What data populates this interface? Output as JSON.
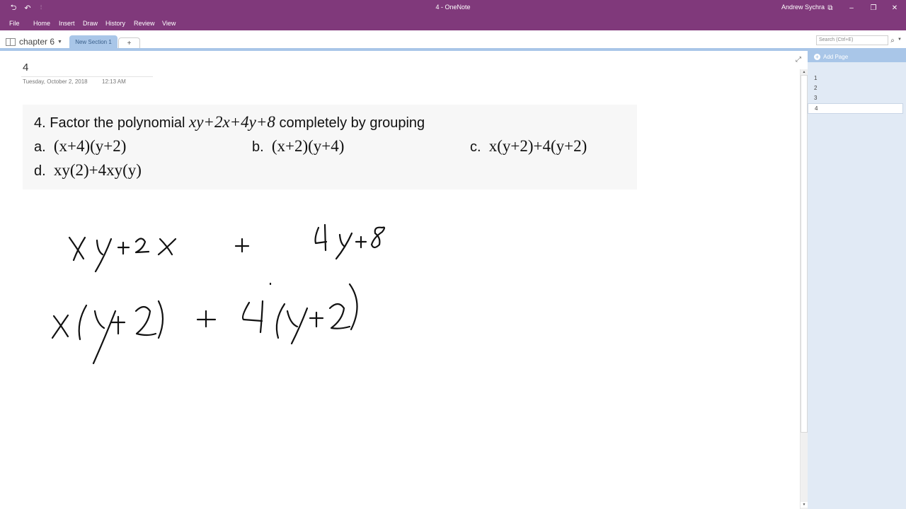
{
  "window": {
    "title": "4 - OneNote",
    "user": "Andrew Sychra",
    "quick_access": [
      "back-icon",
      "undo-icon",
      "customize-icon"
    ],
    "controls": [
      "ribbon-display-icon",
      "minimize-icon",
      "restore-icon",
      "close-icon"
    ]
  },
  "ribbon": {
    "tabs": [
      "File",
      "Home",
      "Insert",
      "Draw",
      "History",
      "Review",
      "View"
    ]
  },
  "notebook": {
    "name": "chapter 6",
    "section_tabs": [
      {
        "label": "New Section 1",
        "active": true
      }
    ],
    "add_section_label": "+"
  },
  "search": {
    "placeholder": "Search (Ctrl+E)"
  },
  "page": {
    "title": "4",
    "date": "Tuesday, October 2, 2018",
    "time": "12:13 AM"
  },
  "problem": {
    "number": "4.",
    "prompt_prefix": "Factor the polynomial",
    "expression": "xy+2x+4y+8",
    "prompt_suffix": "completely by grouping",
    "choices": [
      {
        "letter": "a.",
        "answer": "(x+4)(y+2)"
      },
      {
        "letter": "b.",
        "answer": "(x+2)(y+4)"
      },
      {
        "letter": "c.",
        "answer": "x(y+2)+4(y+2)"
      },
      {
        "letter": "d.",
        "answer": "xy(2)+4xy(y)"
      }
    ]
  },
  "handwriting": {
    "line1": "xy+2x + 4y+8",
    "line2": "x(y+2) + 4(y+2)"
  },
  "pages_panel": {
    "add_page_label": "Add Page",
    "pages": [
      {
        "label": "1",
        "active": false
      },
      {
        "label": "2",
        "active": false
      },
      {
        "label": "3",
        "active": false
      },
      {
        "label": "4",
        "active": true
      }
    ]
  }
}
